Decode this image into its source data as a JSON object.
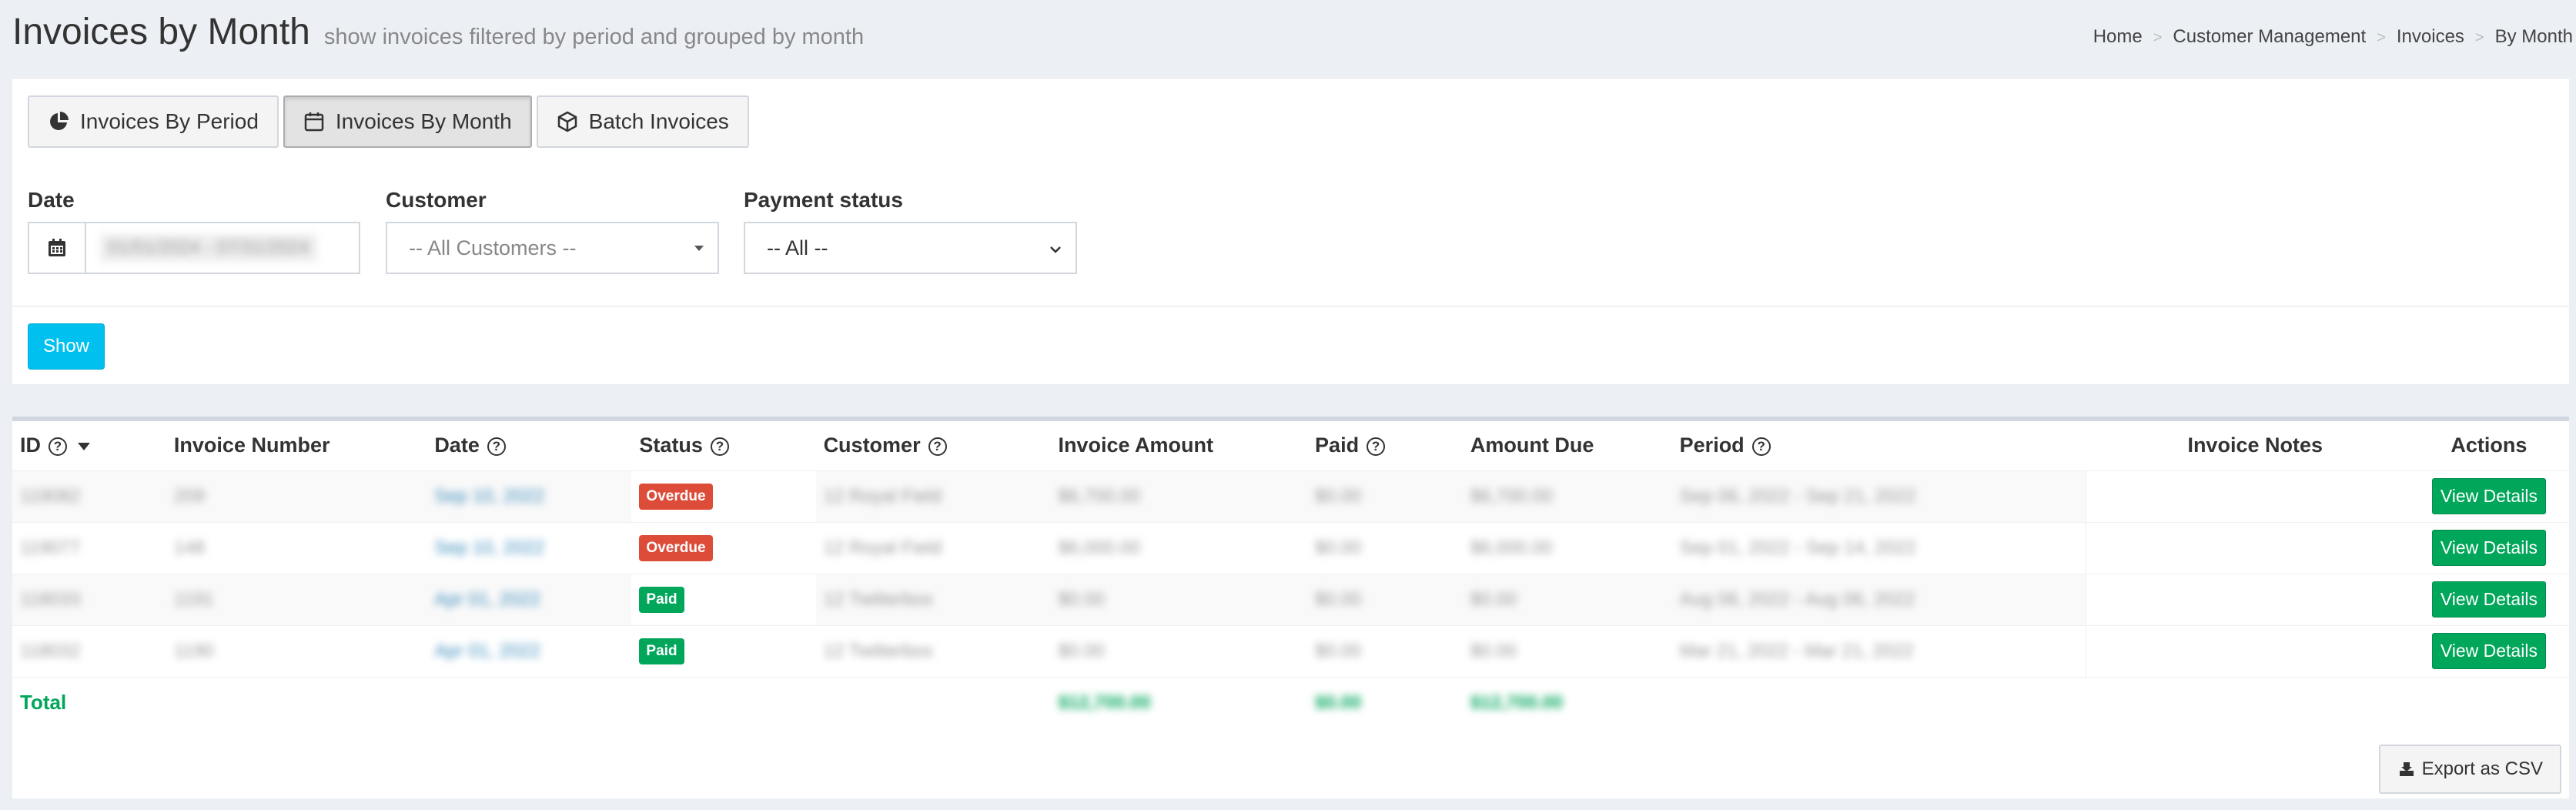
{
  "header": {
    "title": "Invoices by Month",
    "subtitle": "show invoices filtered by period and grouped by month",
    "breadcrumb": [
      "Home",
      "Customer Management",
      "Invoices",
      "By Month"
    ]
  },
  "tabs": [
    {
      "label": "Invoices By Period",
      "icon": "pie-chart-icon",
      "active": false
    },
    {
      "label": "Invoices By Month",
      "icon": "calendar-icon",
      "active": true
    },
    {
      "label": "Batch Invoices",
      "icon": "cube-icon",
      "active": false
    }
  ],
  "filters": {
    "date_label": "Date",
    "date_value": "01/01/2024 - 07/31/2024",
    "customer_label": "Customer",
    "customer_value": "-- All Customers --",
    "status_label": "Payment status",
    "status_value": "-- All --",
    "show_button": "Show"
  },
  "table": {
    "headers": [
      "ID",
      "Invoice Number",
      "Date",
      "Status",
      "Customer",
      "Invoice Amount",
      "Paid",
      "Amount Due",
      "Period",
      "Invoice Notes",
      "Actions"
    ],
    "rows": [
      {
        "id": "119082",
        "number": "209",
        "date": "Sep 10, 2022",
        "status": "Overdue",
        "customer": "12 Royal Field",
        "amount": "$6,700.00",
        "paid": "$0.00",
        "due": "$6,700.00",
        "period": "Sep 06, 2022 - Sep 21, 2022",
        "notes": "",
        "action": "View Details"
      },
      {
        "id": "119077",
        "number": "148",
        "date": "Sep 10, 2022",
        "status": "Overdue",
        "customer": "12 Royal Field",
        "amount": "$6,000.00",
        "paid": "$0.00",
        "due": "$6,000.00",
        "period": "Sep 01, 2022 - Sep 14, 2022",
        "notes": "",
        "action": "View Details"
      },
      {
        "id": "118033",
        "number": "1191",
        "date": "Apr 01, 2022",
        "status": "Paid",
        "customer": "12 Twitterbox",
        "amount": "$0.00",
        "paid": "$0.00",
        "due": "$0.00",
        "period": "Aug 06, 2022 - Aug 06, 2022",
        "notes": "",
        "action": "View Details"
      },
      {
        "id": "118032",
        "number": "1190",
        "date": "Apr 01, 2022",
        "status": "Paid",
        "customer": "12 Twitterbox",
        "amount": "$0.00",
        "paid": "$0.00",
        "due": "$0.00",
        "period": "Mar 21, 2022 - Mar 21, 2022",
        "notes": "",
        "action": "View Details"
      }
    ],
    "total_label": "Total",
    "total_amount": "$12,700.00",
    "total_paid": "$0.00",
    "total_due": "$12,700.00",
    "export_button": "Export as CSV"
  },
  "colors": {
    "overdue": "#dd4b39",
    "paid": "#00a65a",
    "show_button": "#00c0ef",
    "link": "#3c8dbc"
  }
}
